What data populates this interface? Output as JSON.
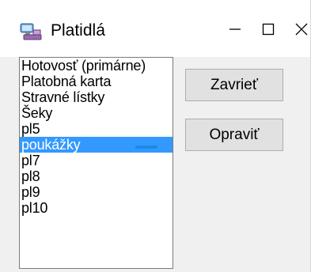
{
  "window": {
    "title": "Platidlá",
    "icon": "cashier-icon",
    "controls": {
      "minimize": "minimize-icon",
      "maximize": "maximize-icon",
      "close": "close-icon"
    }
  },
  "payment_list": {
    "items": [
      "Hotovosť (primárne)",
      "Platobná karta",
      "Stravné lístky",
      "Šeky",
      "pl5",
      "poukážky",
      "pl7",
      "pl8",
      "pl9",
      "pl10"
    ],
    "selected_index": 5
  },
  "buttons": {
    "close_label": "Zavrieť",
    "edit_label": "Opraviť"
  },
  "colors": {
    "selection": "#3399ff",
    "window_bg": "#f0f0f0",
    "button_bg": "#e1e1e1"
  }
}
